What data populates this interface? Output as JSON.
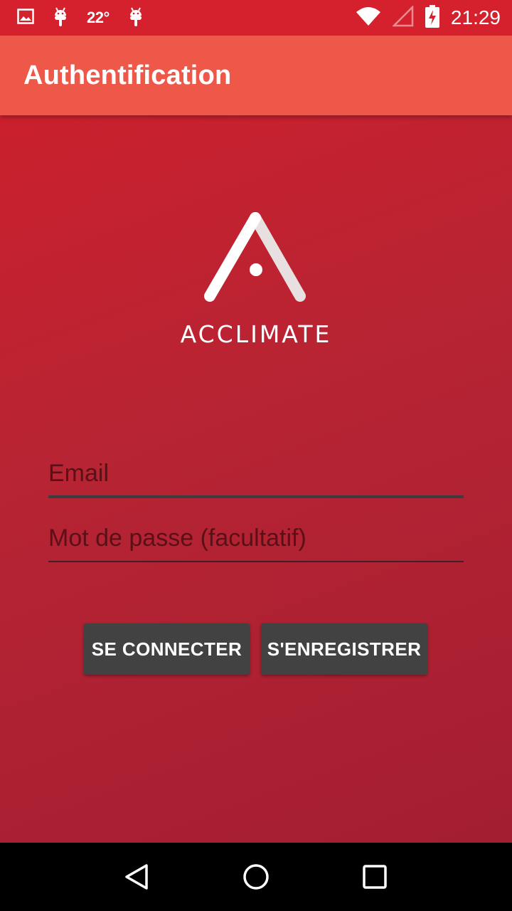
{
  "status_bar": {
    "icons_left": [
      "image-icon",
      "android-icon",
      "android-icon"
    ],
    "temperature": "22°",
    "icons_right": [
      "wifi-icon",
      "signal-icon",
      "battery-charging-icon"
    ],
    "time": "21:29"
  },
  "app_bar": {
    "title": "Authentification"
  },
  "logo": {
    "wordmark": "ACCLIMATE"
  },
  "form": {
    "email": {
      "placeholder": "Email",
      "value": ""
    },
    "password": {
      "placeholder": "Mot de passe (facultatif)",
      "value": ""
    }
  },
  "actions": {
    "login_label": "SE CONNECTER",
    "register_label": "S'ENREGISTRER"
  },
  "nav_bar": {
    "buttons": [
      "back-icon",
      "home-icon",
      "recents-icon"
    ]
  },
  "colors": {
    "status_bar": "#d5212e",
    "app_bar": "#ee5849",
    "background_start": "#d11f2c",
    "background_end": "#a11d32",
    "button": "#424242"
  }
}
